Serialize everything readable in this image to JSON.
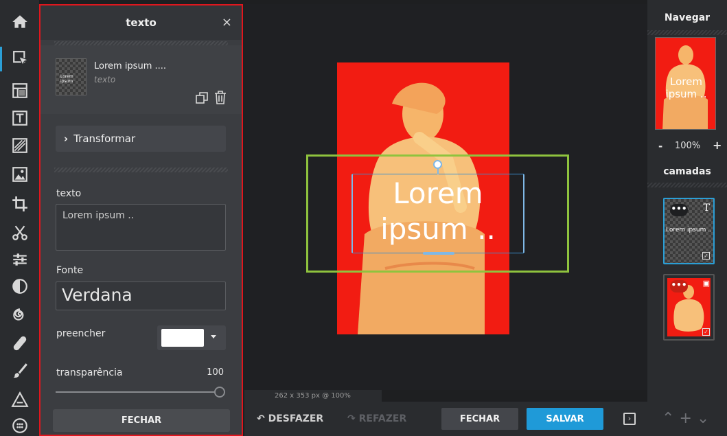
{
  "toolbar": {
    "tools": [
      "home-icon",
      "select-arrow-icon",
      "grid-layout-icon",
      "text-tool-icon",
      "texture-icon",
      "image-icon",
      "crop-icon",
      "scissors-icon",
      "sliders-icon",
      "contrast-icon",
      "spiral-icon",
      "bandage-icon",
      "brush-icon",
      "triangle-ruler-icon",
      "globe-icon"
    ]
  },
  "panel": {
    "title": "texto",
    "close_glyph": "×",
    "layer_name": "Lorem ipsum ....",
    "layer_type": "texto",
    "thumb_text": "Lorem ipsum",
    "transform_label": "Transformar",
    "text_label": "texto",
    "text_value": "Lorem ipsum ..",
    "font_label": "Fonte",
    "font_value": "Verdana",
    "fill_label": "preencher",
    "fill_color": "#ffffff",
    "opacity_label": "transparência",
    "opacity_value": "100",
    "close_button": "FECHAR"
  },
  "canvas": {
    "text_line1": "Lorem",
    "text_line2": "ipsum ..",
    "image_color": "#f21c12",
    "status": "262 x 353 px @ 100%"
  },
  "bottom": {
    "undo": "DESFAZER",
    "redo": "REFAZER",
    "close": "FECHAR",
    "save": "SALVAR",
    "save_color": "#1f9ad8"
  },
  "right": {
    "navigate_title": "Navegar",
    "nav_thumb_text": "Lorem ipsum ..",
    "zoom_minus": "-",
    "zoom_value": "100%",
    "zoom_plus": "+",
    "layers_title": "camadas",
    "layer1_text": "Lorem ipsum ..",
    "layer_menu": "•••"
  }
}
